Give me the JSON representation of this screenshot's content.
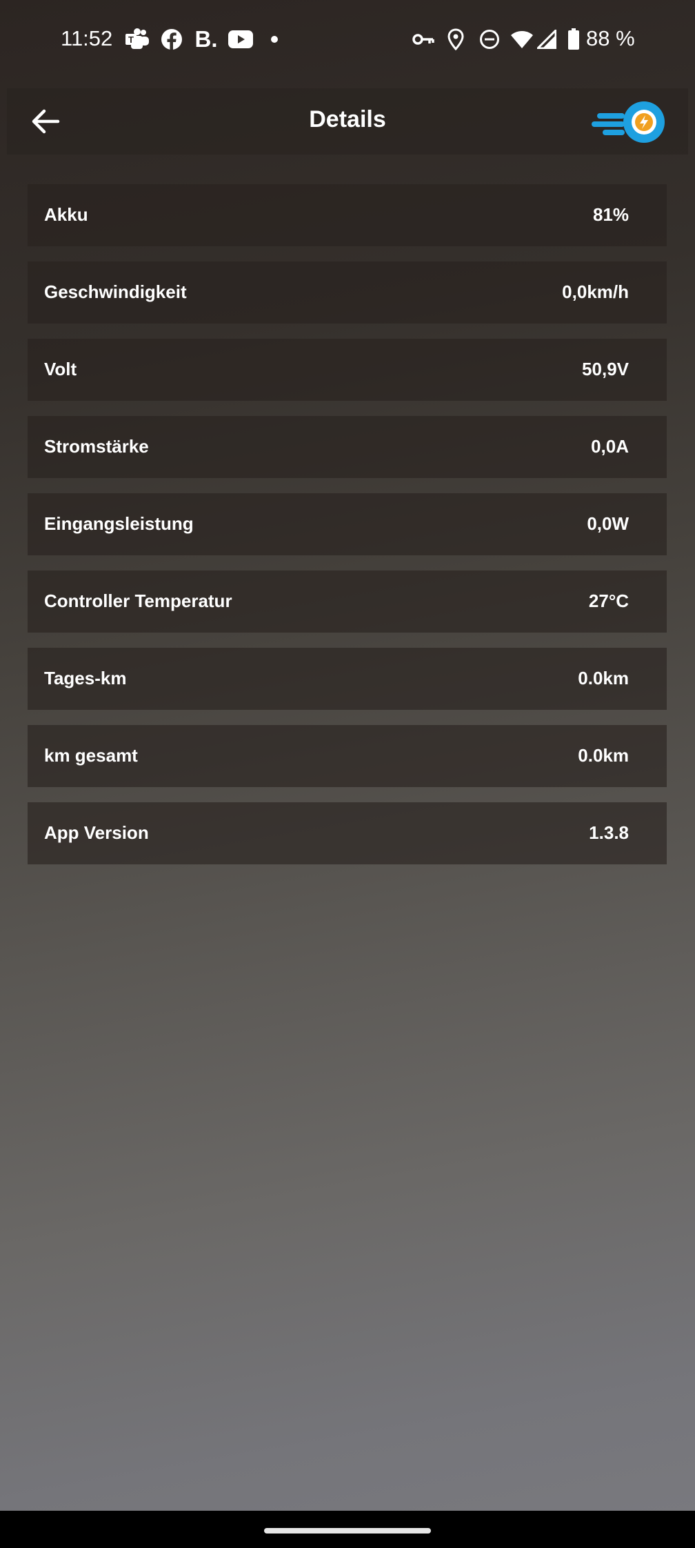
{
  "status_bar": {
    "time": "11:52",
    "battery_percent": "88 %",
    "icons": [
      "teams-icon",
      "facebook-icon",
      "booking-icon",
      "youtube-icon",
      "notification-dot-icon",
      "vpn-key-icon",
      "location-icon",
      "do-not-disturb-icon",
      "wifi-icon",
      "cell-signal-icon",
      "battery-icon"
    ]
  },
  "header": {
    "title": "Details",
    "back_icon": "arrow-left-icon",
    "logo_icon": "speed-charge-logo-icon",
    "accent_color": "#1ea0e0",
    "logo_badge_color": "#f0a020"
  },
  "details": [
    {
      "label": "Akku",
      "value": "81%"
    },
    {
      "label": "Geschwindigkeit",
      "value": "0,0km/h"
    },
    {
      "label": "Volt",
      "value": "50,9V"
    },
    {
      "label": "Stromstärke",
      "value": "0,0A"
    },
    {
      "label": "Eingangsleistung",
      "value": "0,0W"
    },
    {
      "label": "Controller Temperatur",
      "value": "27°C"
    },
    {
      "label": "Tages-km",
      "value": "0.0km"
    },
    {
      "label": "km gesamt",
      "value": "0.0km"
    },
    {
      "label": "App Version",
      "value": "1.3.8"
    }
  ]
}
